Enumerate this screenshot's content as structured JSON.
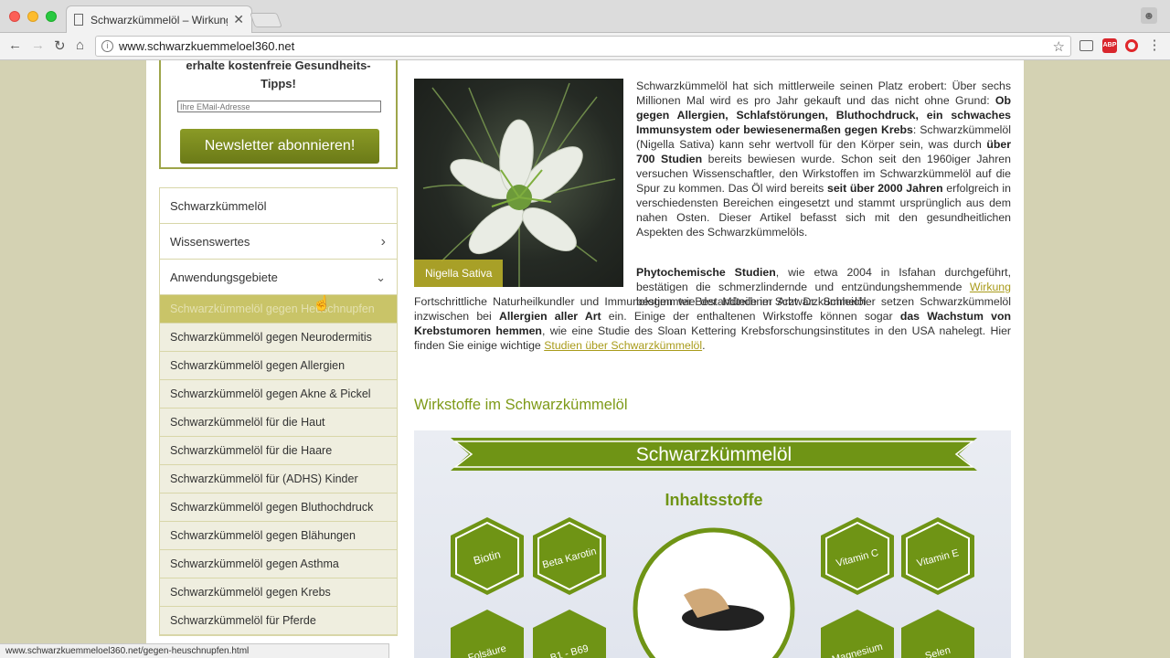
{
  "browser": {
    "tab_title": "Schwarzkümmelöl – Wirkung, I",
    "tab_close": "✕",
    "url": "www.schwarzkuemmeloel360.net",
    "status_url": "www.schwarzkuemmeloel360.net/gegen-heuschnupfen.html",
    "ext_abp": "ABP"
  },
  "newsletter": {
    "title_line1": "erhalte kostenfreie Gesundheits-",
    "title_line2": "Tipps!",
    "email_placeholder": "Ihre EMail-Adresse",
    "button": "Newsletter abonnieren!"
  },
  "nav": {
    "main": [
      {
        "label": "Schwarzkümmelöl"
      },
      {
        "label": "Wissenswertes",
        "chevron": "›"
      },
      {
        "label": "Anwendungsgebiete",
        "chevron": "⌄"
      }
    ],
    "sub": [
      "Schwarzkümmelöl gegen Heuschnupfen",
      "Schwarzkümmelöl gegen Neurodermitis",
      "Schwarzkümmelöl gegen Allergien",
      "Schwarzkümmelöl gegen Akne & Pickel",
      "Schwarzkümmelöl für die Haut",
      "Schwarzkümmelöl für die Haare",
      "Schwarzkümmelöl für (ADHS) Kinder",
      "Schwarzkümmelöl gegen Bluthochdruck",
      "Schwarzkümmelöl gegen Blähungen",
      "Schwarzkümmelöl gegen Asthma",
      "Schwarzkümmelöl gegen Krebs",
      "Schwarzkümmelöl für Pferde"
    ]
  },
  "article": {
    "image_caption": "Nigella Sativa",
    "p1_a": "Schwarzkümmelöl hat sich mittlerweile seinen Platz erobert: Über sechs Millionen Mal wird es pro Jahr gekauft und das nicht ohne Grund: ",
    "p1_b": "Ob gegen Allergien, Schlafstörungen, Bluthochdruck, ein schwaches Immunsystem oder bewiesenermaßen gegen Krebs",
    "p1_c": ": Schwarzkümmelöl (Nigella Sativa) kann sehr wertvoll für den Körper sein, was durch ",
    "p1_d": "über 700 Studien",
    "p1_e": " bereits bewiesen wurde. Schon seit den 1960iger Jahren versuchen Wissenschaftler, den Wirkstoffen im Schwarzkümmelöl auf die Spur zu kommen. Das Öl wird bereits ",
    "p1_f": "seit über 2000 Jahren",
    "p1_g": " erfolgreich in verschiedensten Bereichen eingesetzt und stammt ursprünglich aus dem nahen Osten. Dieser Artikel befasst sich mit den gesundheitlichen Aspekten des Schwarzkümmelöls.",
    "p2_a": "Phytochemische Studien",
    "p2_b": ", wie etwa 2004 in Isfahan durchgeführt, bestätigen die schmerzlindernde und entzündungshemmende ",
    "p2_link": "Wirkung",
    "p2_c": " bestimmter Bestandteile im Schwarzkümmelöl.",
    "p2_d": "Fortschrittliche Naturheilkundler und Immunologen wie der Münchner Arzt Dr. Schleicher setzen Schwarzkümmelöl inzwischen bei ",
    "p2_e": "Allergien aller Art",
    "p2_f": " ein. Einige der enthaltenen Wirkstoffe können sogar ",
    "p2_g": "das Wachstum von Krebstumoren hemmen",
    "p2_h": ", wie eine Studie des Sloan Kettering Krebsforschungsinstitutes in den USA nahelegt. Hier finden Sie einige wichtige ",
    "p2_link2": "Studien über Schwarzkümmelöl",
    "p2_i": ".",
    "heading": "Wirkstoffe im Schwarzkümmelöl"
  },
  "infographic": {
    "banner": "Schwarzkümmelöl",
    "subtitle": "Inhaltsstoffe",
    "hexes": [
      "Biotin",
      "Beta Karotin",
      "Vitamin C",
      "Vitamin E",
      "Folsäure",
      "B1 - B69",
      "Magnesium",
      "Selen"
    ]
  },
  "colors": {
    "accent": "#7e9a18",
    "banner": "#6f9415",
    "link": "#a99b1a",
    "page_bg": "#d4d2b3"
  }
}
